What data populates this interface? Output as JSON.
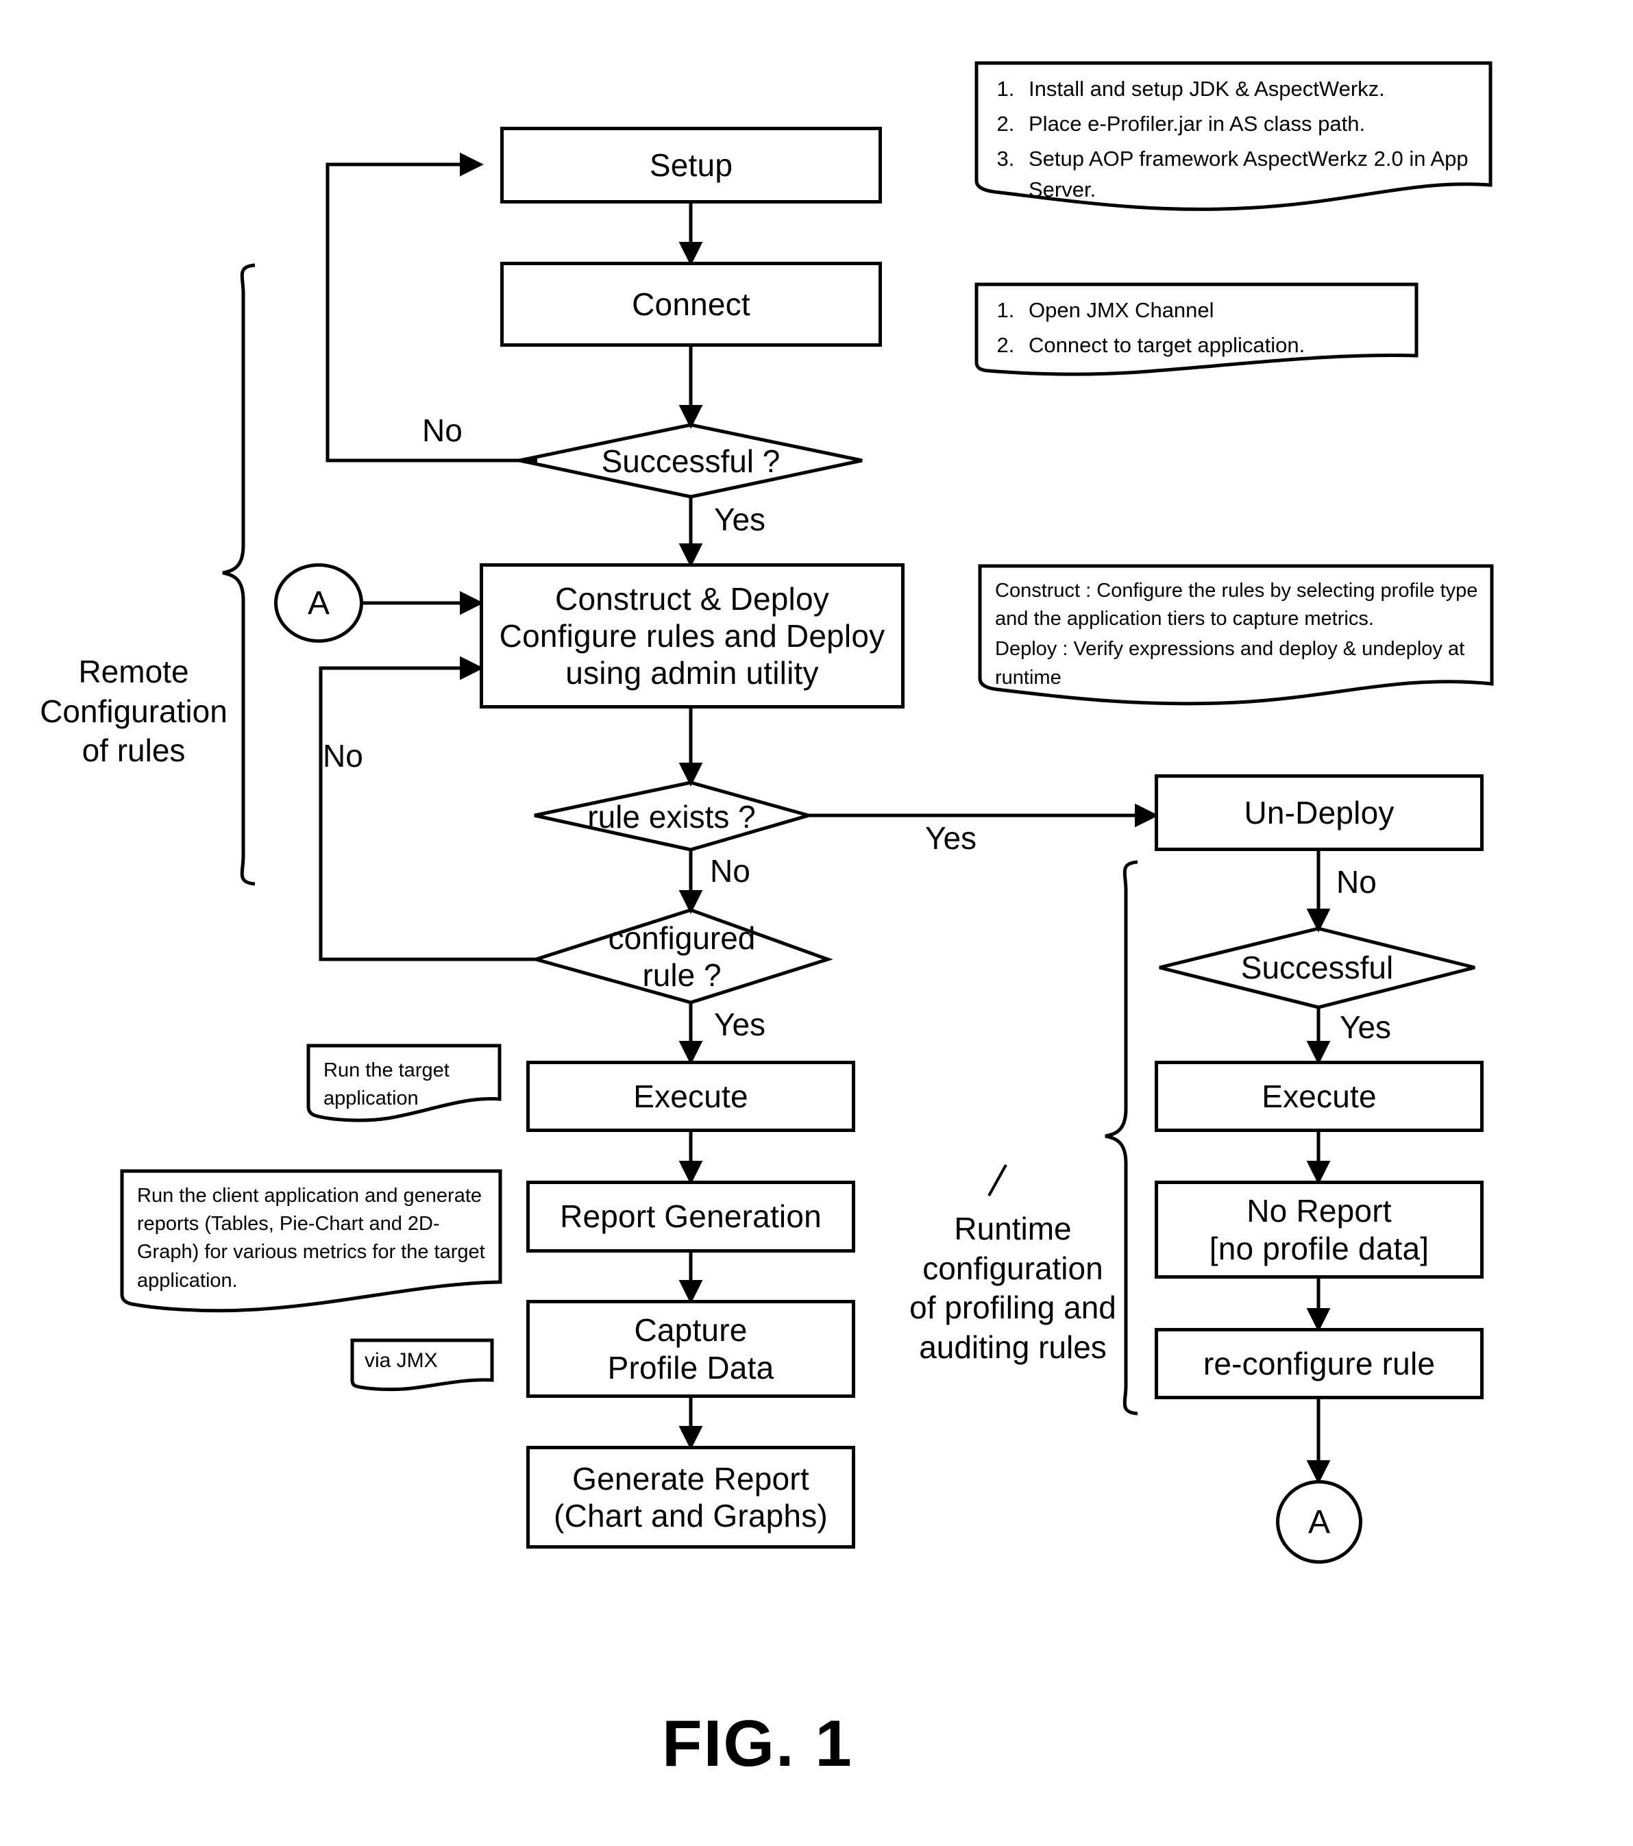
{
  "figure": {
    "caption": "FIG. 1"
  },
  "nodes": {
    "setup": "Setup",
    "connect": "Connect",
    "successful_q": "Successful ?",
    "construct_deploy": "Construct & Deploy\nConfigure rules and Deploy\nusing admin utility",
    "rule_exists_q": "rule exists ?",
    "configured_rule_q": "configured\nrule ?",
    "execute_left": "Execute",
    "report_generation": "Report Generation",
    "capture_profile_data": "Capture\nProfile Data",
    "generate_report": "Generate Report\n(Chart and Graphs)",
    "un_deploy": "Un-Deploy",
    "successful_right": "Successful",
    "execute_right": "Execute",
    "no_report": "No Report\n[no profile data]",
    "re_configure_rule": "re-configure rule",
    "connector_a_left": "A",
    "connector_a_bottom": "A"
  },
  "edge_labels": {
    "successful_no": "No",
    "successful_yes": "Yes",
    "construct_loop_no": "No",
    "rule_exists_yes": "Yes",
    "rule_exists_no": "No",
    "configured_rule_yes": "Yes",
    "undeploy_no": "No",
    "successful_right_yes": "Yes"
  },
  "brace_labels": {
    "remote": "Remote\nConfiguration\nof rules",
    "runtime": "Runtime\nconfiguration\nof profiling and\nauditing rules"
  },
  "notes": {
    "setup_note": {
      "items": [
        "Install and setup JDK & AspectWerkz.",
        "Place e-Profiler.jar in AS class path.",
        "Setup AOP framework AspectWerkz 2.0 in App Server."
      ]
    },
    "connect_note": {
      "items": [
        "Open JMX Channel",
        "Connect to target application."
      ]
    },
    "construct_note": {
      "lines": [
        "Construct : Configure the rules by selecting profile type and the application tiers to capture metrics.",
        "Deploy : Verify expressions and deploy & undeploy at runtime"
      ]
    },
    "run_target_note": {
      "text": "Run the target application"
    },
    "run_client_note": {
      "text": "Run the client application and generate reports (Tables, Pie-Chart and 2D-Graph) for various metrics for the target application."
    },
    "via_jmx_note": {
      "text": "via JMX"
    }
  },
  "colors": {
    "stroke": "#000000",
    "background": "#ffffff"
  }
}
